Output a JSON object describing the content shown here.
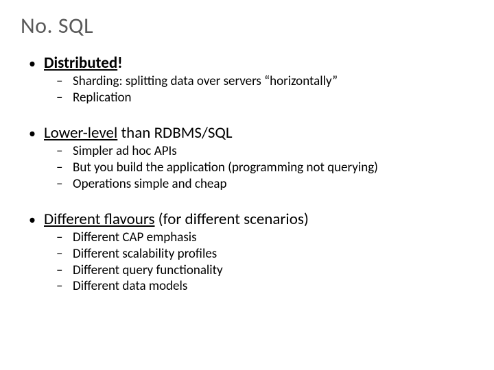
{
  "title": "No. SQL",
  "bullets": [
    {
      "label_bold_ul": "Distributed",
      "label_suffix": "!",
      "sub": [
        "Sharding: splitting data over servers “horizontally”",
        "Replication"
      ]
    },
    {
      "label_ul": "Lower-level",
      "label_plain": " than RDBMS/SQL",
      "sub": [
        "Simpler ad hoc APIs",
        "But you build the application (programming not querying)",
        "Operations simple and cheap"
      ]
    },
    {
      "label_ul": "Different flavours",
      "label_plain": " (for different scenarios)",
      "sub": [
        "Different CAP emphasis",
        "Different scalability profiles",
        "Different query functionality",
        "Different data models"
      ]
    }
  ]
}
